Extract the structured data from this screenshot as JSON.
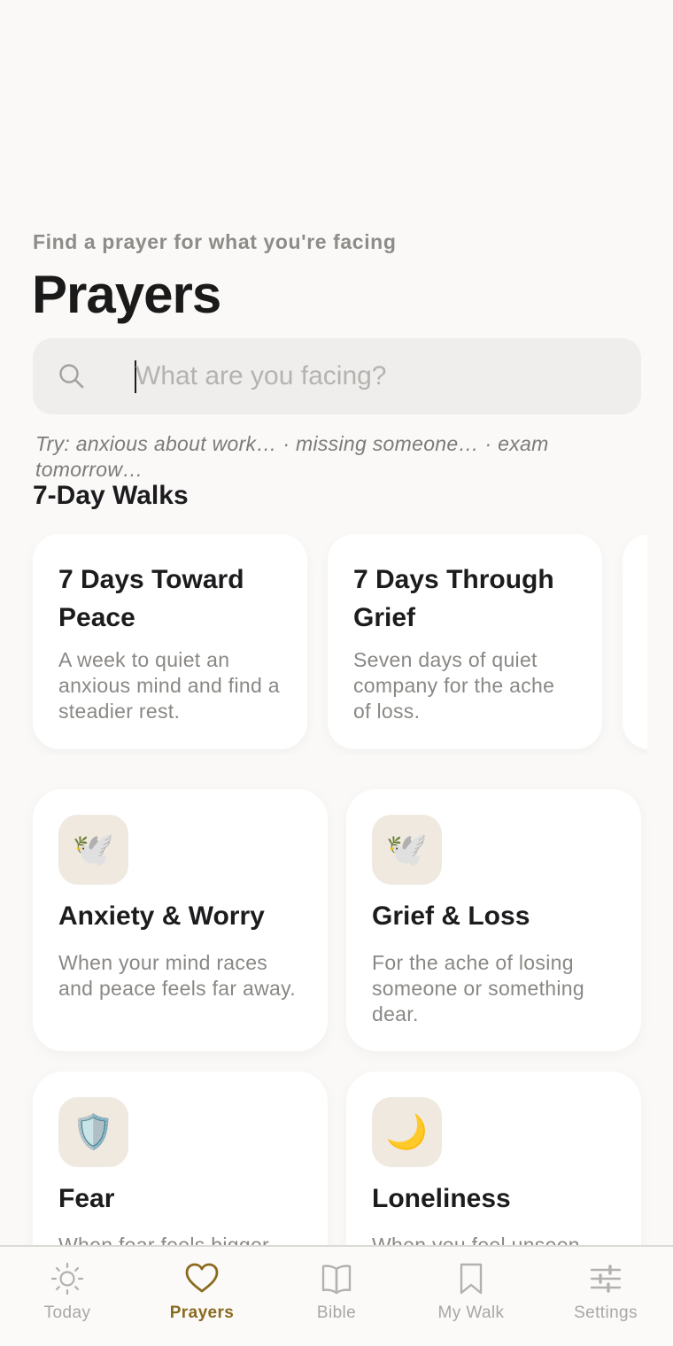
{
  "header": {
    "subtitle": "Find a prayer for what you're facing",
    "title": "Prayers"
  },
  "search": {
    "placeholder": "What are you facing?",
    "value": "",
    "icon": "search-icon"
  },
  "hint": "Try: anxious about work… · missing someone… · exam tomorrow…",
  "walks": {
    "section_title": "7-Day Walks",
    "items": [
      {
        "title": "7 Days Toward Peace",
        "description": "A week to quiet an anxious mind and find a steadier rest."
      },
      {
        "title": "7 Days Through Grief",
        "description": "Seven days of quiet company for the ache of loss."
      }
    ]
  },
  "topics": [
    {
      "title": "Anxiety & Worry",
      "description": "When your mind races and peace feels far away.",
      "icon": "🕊️",
      "icon_name": "wind-dove-icon"
    },
    {
      "title": "Grief & Loss",
      "description": "For the ache of losing someone or something dear.",
      "icon": "🕊️",
      "icon_name": "dove-icon"
    },
    {
      "title": "Fear",
      "description": "When fear feels bigger",
      "icon": "🛡️",
      "icon_name": "shield-icon"
    },
    {
      "title": "Loneliness",
      "description": "When you feel unseen",
      "icon": "🌙",
      "icon_name": "moon-icon"
    }
  ],
  "tabbar": {
    "items": [
      {
        "label": "Today",
        "icon": "sun-icon",
        "active": false
      },
      {
        "label": "Prayers",
        "icon": "heart-icon",
        "active": true
      },
      {
        "label": "Bible",
        "icon": "book-icon",
        "active": false
      },
      {
        "label": "My Walk",
        "icon": "bookmark-icon",
        "active": false
      },
      {
        "label": "Settings",
        "icon": "sliders-icon",
        "active": false
      }
    ]
  },
  "colors": {
    "background": "#faf9f7",
    "card": "#ffffff",
    "icon_tile": "#efe9df",
    "accent": "#8a6a1f",
    "muted_text": "#8a8885"
  }
}
